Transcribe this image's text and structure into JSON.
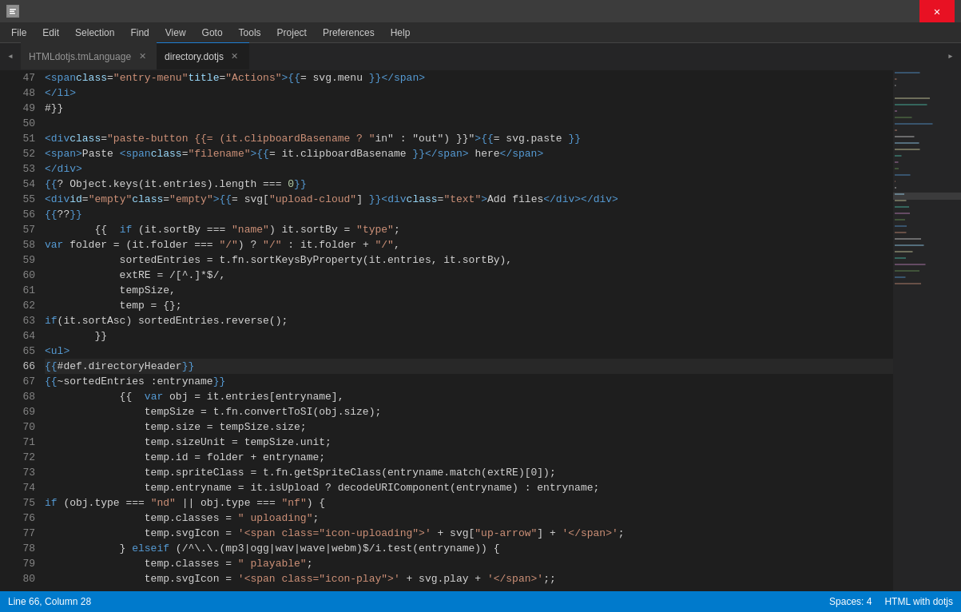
{
  "titleBar": {
    "appIcon": "sublime-icon",
    "closeLabel": "✕"
  },
  "menuBar": {
    "items": [
      "File",
      "Edit",
      "Selection",
      "Find",
      "View",
      "Goto",
      "Tools",
      "Project",
      "Preferences",
      "Help"
    ]
  },
  "tabs": [
    {
      "id": "tab1",
      "label": "HTMLdotjs.tmLanguage",
      "active": false,
      "modified": false
    },
    {
      "id": "tab2",
      "label": "directory.dotjs",
      "active": true,
      "modified": false
    }
  ],
  "editor": {
    "startLine": 47,
    "activeLine": 66,
    "lines": [
      {
        "num": 47,
        "indent": "            ",
        "content": "<span class=\"entry-menu\" title=\"Actions\">{{= svg.menu }}</span>"
      },
      {
        "num": 48,
        "indent": "        ",
        "content": "</li>"
      },
      {
        "num": 49,
        "indent": "",
        "content": "#}}"
      },
      {
        "num": 50,
        "indent": "",
        "content": ""
      },
      {
        "num": 51,
        "indent": "",
        "content": "<div class=\"paste-button {{= (it.clipboardBasename ? \"in\" : \"out\") }}\"> {{= svg.paste }}"
      },
      {
        "num": 52,
        "indent": "        ",
        "content": "<span>Paste <span class=\"filename\">{{= it.clipboardBasename }}</span> here</span>"
      },
      {
        "num": 53,
        "indent": "",
        "content": "</div>"
      },
      {
        "num": 54,
        "indent": "",
        "content": "{{? Object.keys(it.entries).length === 0 }}"
      },
      {
        "num": 55,
        "indent": "        ",
        "content": "<div id=\"empty\" class=\"empty\">{{= svg[\"upload-cloud\"] }}<div class=\"text\">Add files</div></div>"
      },
      {
        "num": 56,
        "indent": "",
        "content": "{{??}}"
      },
      {
        "num": 57,
        "indent": "        ",
        "content": "{{  if (it.sortBy === \"name\") it.sortBy = \"type\";"
      },
      {
        "num": 58,
        "indent": "        ",
        "content": "    var folder = (it.folder === \"/\") ? \"/\" : it.folder + \"/\","
      },
      {
        "num": 59,
        "indent": "            ",
        "content": "sortedEntries = t.fn.sortKeysByProperty(it.entries, it.sortBy),"
      },
      {
        "num": 60,
        "indent": "            ",
        "content": "extRE = /[^.]*$/,"
      },
      {
        "num": 61,
        "indent": "            ",
        "content": "tempSize,"
      },
      {
        "num": 62,
        "indent": "            ",
        "content": "temp = {};"
      },
      {
        "num": 63,
        "indent": "        ",
        "content": "if(it.sortAsc) sortedEntries.reverse();"
      },
      {
        "num": 64,
        "indent": "        ",
        "content": "}}"
      },
      {
        "num": 65,
        "indent": "        ",
        "content": "<ul>"
      },
      {
        "num": 66,
        "indent": "            ",
        "content": "{{#def.directoryHeader}}"
      },
      {
        "num": 67,
        "indent": "            ",
        "content": "{{~sortedEntries :entryname}}"
      },
      {
        "num": 68,
        "indent": "            ",
        "content": "{{  var obj = it.entries[entryname],"
      },
      {
        "num": 69,
        "indent": "                ",
        "content": "tempSize = t.fn.convertToSI(obj.size);"
      },
      {
        "num": 70,
        "indent": "                ",
        "content": "temp.size = tempSize.size;"
      },
      {
        "num": 71,
        "indent": "                ",
        "content": "temp.sizeUnit = tempSize.unit;"
      },
      {
        "num": 72,
        "indent": "                ",
        "content": "temp.id = folder + entryname;"
      },
      {
        "num": 73,
        "indent": "                ",
        "content": "temp.spriteClass = t.fn.getSpriteClass(entryname.match(extRE)[0]);"
      },
      {
        "num": 74,
        "indent": "                ",
        "content": "temp.entryname = it.isUpload ? decodeURIComponent(entryname) : entryname;"
      },
      {
        "num": 75,
        "indent": "            ",
        "content": "if (obj.type === \"nd\" || obj.type === \"nf\") {"
      },
      {
        "num": 76,
        "indent": "                ",
        "content": "temp.classes = \" uploading\";"
      },
      {
        "num": 77,
        "indent": "                ",
        "content": "temp.svgIcon = '<span class=\"icon-uploading\">' + svg[\"up-arrow\"] + '</span>';"
      },
      {
        "num": 78,
        "indent": "            ",
        "content": "} else if (/^\\.\\.(mp3|ogg|wav|wave|webm)$/i.test(entryname)) {"
      },
      {
        "num": 79,
        "indent": "                ",
        "content": "temp.classes = \" playable\";"
      },
      {
        "num": 80,
        "indent": "                ",
        "content": "temp.svgIcon = '<span class=\"icon-play\">' + svg.play + '</span>';;"
      }
    ]
  },
  "statusBar": {
    "position": "Line 66, Column 28",
    "indentation": "Spaces: 4",
    "syntax": "HTML with dotjs"
  }
}
